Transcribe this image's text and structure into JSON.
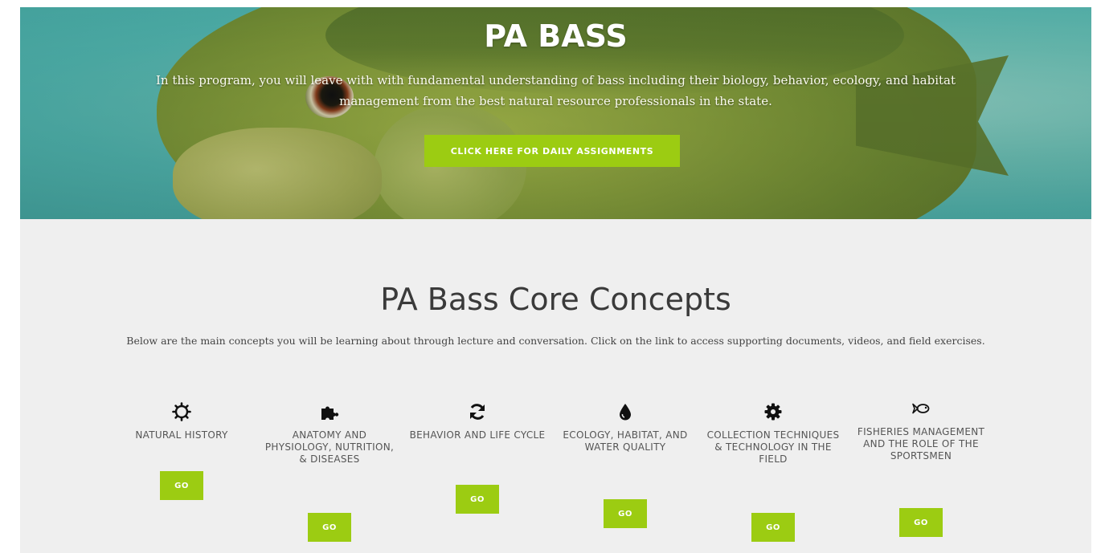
{
  "hero": {
    "title": "PA BASS",
    "text": "In this program, you will leave with with fundamental understanding of bass including their biology, behavior, ecology, and habitat management from the best natural resource professionals in the state.",
    "button_label": "CLICK HERE FOR DAILY ASSIGNMENTS"
  },
  "concepts": {
    "title": "PA Bass Core Concepts",
    "intro": "Below are the main concepts you will be learning about through lecture and conversation.  Click on the link to access supporting documents, videos, and field exercises.",
    "items": [
      {
        "icon": "sun-icon",
        "label": "NATURAL HISTORY",
        "button_label": "GO"
      },
      {
        "icon": "puzzle-icon",
        "label": "ANATOMY AND PHYSIOLOGY, NUTRITION, & DISEASES",
        "button_label": "GO"
      },
      {
        "icon": "refresh-icon",
        "label": "BEHAVIOR AND LIFE CYCLE",
        "button_label": "GO"
      },
      {
        "icon": "water-drop-icon",
        "label": "ECOLOGY, HABITAT, AND WATER QUALITY",
        "button_label": "GO"
      },
      {
        "icon": "gear-icon",
        "label": "COLLECTION TECHNIQUES & TECHNOLOGY IN THE FIELD",
        "button_label": "GO"
      },
      {
        "icon": "fish-icon",
        "label": "FISHERIES MANAGEMENT AND THE ROLE OF THE SPORTSMEN",
        "button_label": "GO"
      }
    ]
  },
  "colors": {
    "accent": "#9ccc12",
    "section_bg": "#efefef",
    "hero_water": "#4fb3ad"
  }
}
